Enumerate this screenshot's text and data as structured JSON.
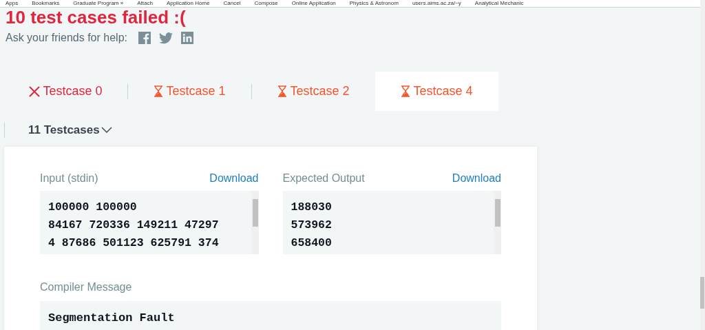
{
  "bookmarks_bar": {
    "items": [
      "Apps",
      "Bookmarks",
      "Graduate Program »",
      "Attach",
      "Application Home",
      "Cancel",
      "Compose",
      "Online Application",
      "Physics & Astronom",
      "users.aims.ac.za/~y",
      "Analytical Mechanic"
    ]
  },
  "result": {
    "title": "10 test cases failed :(",
    "share_label": "Ask your friends for help:"
  },
  "tabs": [
    {
      "label": "Testcase 0",
      "kind": "failed",
      "selected": false
    },
    {
      "label": "Testcase 1",
      "kind": "pending",
      "selected": false
    },
    {
      "label": "Testcase 2",
      "kind": "pending",
      "selected": false
    },
    {
      "label": "Testcase 4",
      "kind": "pending",
      "selected": true
    }
  ],
  "testcase_dropdown": {
    "label": "11 Testcases"
  },
  "panels": [
    {
      "title": "Input (stdin)",
      "link": "Download",
      "lines": [
        "100000 100000",
        "84167 720336 149211 47297",
        "4 87686 501123 625791 374"
      ]
    },
    {
      "title": "Expected Output",
      "link": "Download",
      "lines": [
        "188030",
        "573962",
        "658400"
      ]
    }
  ],
  "compiler_message": {
    "title": "Compiler Message",
    "text": "Segmentation Fault"
  }
}
